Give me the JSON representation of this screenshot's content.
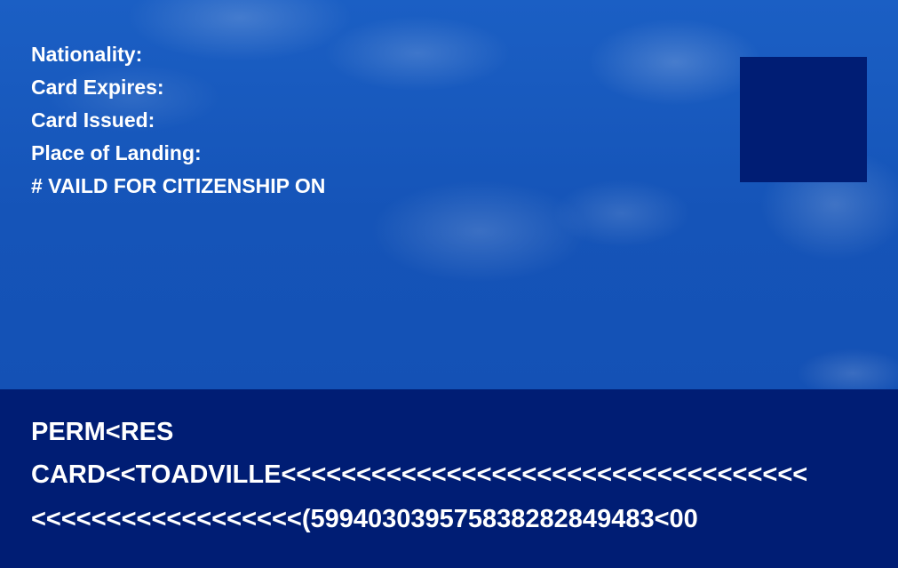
{
  "card": {
    "info_lines": [
      "Nationality:",
      "Card Expires:",
      "Card Issued:",
      "Place of Landing:",
      "# VAILD FOR CITIZENSHIP ON"
    ],
    "mrz_lines": [
      "PERM<RES",
      "CARD<<TOADVILLE<<<<<<<<<<<<<<<<<<<<<<<<<<<<<<<<<<<",
      "<<<<<<<<<<<<<<<<<<(599403039575838282849483<00"
    ]
  },
  "colors": {
    "sky_blue": "#1554b8",
    "band_navy": "#001d74",
    "text": "#ffffff"
  }
}
